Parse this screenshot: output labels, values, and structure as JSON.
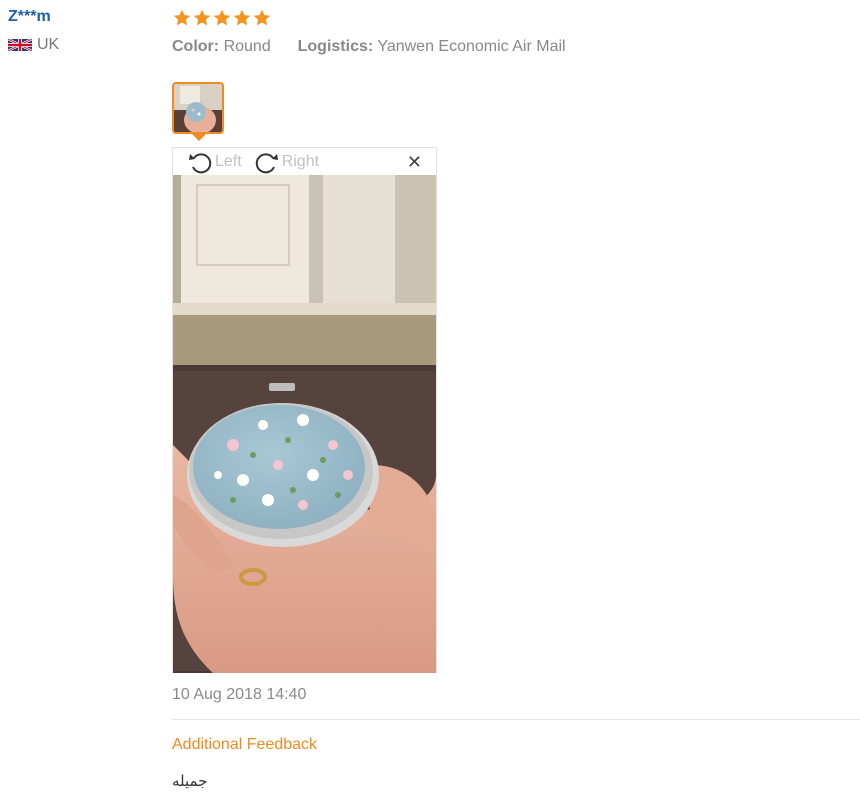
{
  "reviewer": {
    "name": "Z***m",
    "country": "UK",
    "flag_icon": "uk-flag-icon"
  },
  "review": {
    "rating": 5,
    "star_color": "#f7941d",
    "color_label": "Color:",
    "color_value": "Round",
    "logistics_label": "Logistics:",
    "logistics_value": "Yanwen Economic Air Mail",
    "date": "10 Aug 2018 14:40"
  },
  "image_viewer": {
    "rotate_left_label": "Left",
    "rotate_right_label": "Right",
    "rotate_left_icon": "rotate-left-icon",
    "rotate_right_icon": "rotate-right-icon",
    "close_icon": "close-icon",
    "close_glyph": "✕"
  },
  "additional_feedback": {
    "title": "Additional Feedback",
    "text": "جميله"
  },
  "accent_color": "#f08a24",
  "link_color": "#1f5ea8"
}
